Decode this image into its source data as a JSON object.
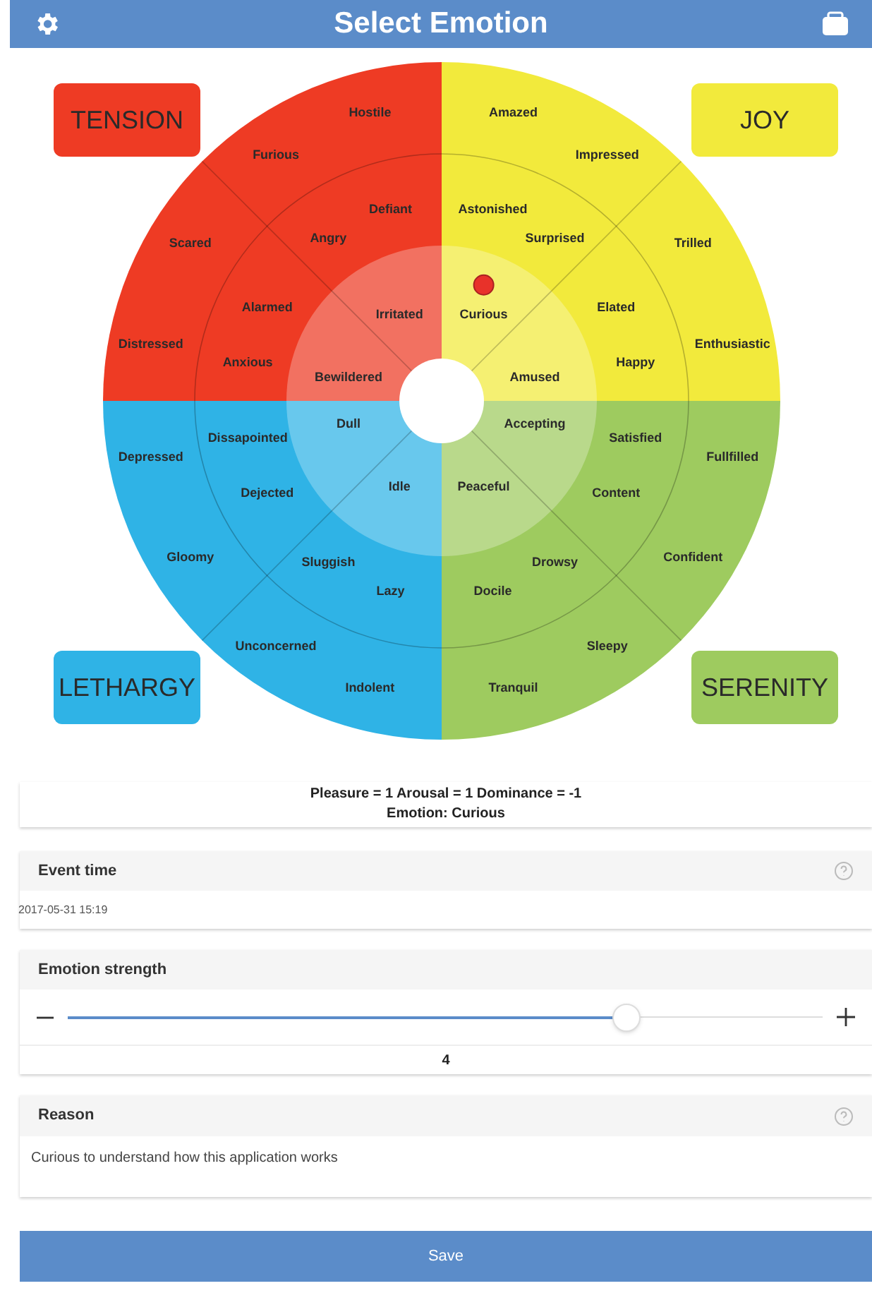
{
  "header": {
    "title": "Select Emotion"
  },
  "wheel": {
    "quadrants": [
      {
        "label": "TENSION",
        "color": "#ee3b24",
        "outer": [
          {
            "text": "Hostile",
            "selected": false
          },
          {
            "text": "Furious",
            "selected": false
          },
          {
            "text": "Scared",
            "selected": false
          },
          {
            "text": "Distressed",
            "selected": false
          }
        ],
        "middle": [
          {
            "text": "Defiant",
            "selected": false
          },
          {
            "text": "Angry",
            "selected": false
          },
          {
            "text": "Alarmed",
            "selected": false
          },
          {
            "text": "Anxious",
            "selected": false
          }
        ],
        "inner": [
          {
            "text": "Irritated",
            "selected": false
          },
          {
            "text": "Bewildered",
            "selected": false
          }
        ]
      },
      {
        "label": "JOY",
        "color": "#f2ea3c",
        "outer": [
          {
            "text": "Amazed",
            "selected": false
          },
          {
            "text": "Impressed",
            "selected": false
          },
          {
            "text": "Trilled",
            "selected": false
          },
          {
            "text": "Enthusiastic",
            "selected": false
          }
        ],
        "middle": [
          {
            "text": "Astonished",
            "selected": false
          },
          {
            "text": "Surprised",
            "selected": false
          },
          {
            "text": "Elated",
            "selected": false
          },
          {
            "text": "Happy",
            "selected": false
          }
        ],
        "inner": [
          {
            "text": "Curious",
            "selected": true
          },
          {
            "text": "Amused",
            "selected": false
          }
        ]
      },
      {
        "label": "LETHARGY",
        "color": "#2fb3e6",
        "outer": [
          {
            "text": "Depressed",
            "selected": false
          },
          {
            "text": "Gloomy",
            "selected": false
          },
          {
            "text": "Unconcerned",
            "selected": false
          },
          {
            "text": "Indolent",
            "selected": false
          }
        ],
        "middle": [
          {
            "text": "Dissapointed",
            "selected": false
          },
          {
            "text": "Dejected",
            "selected": false
          },
          {
            "text": "Sluggish",
            "selected": false
          },
          {
            "text": "Lazy",
            "selected": false
          }
        ],
        "inner": [
          {
            "text": "Dull",
            "selected": false
          },
          {
            "text": "Idle",
            "selected": false
          }
        ]
      },
      {
        "label": "SERENITY",
        "color": "#9ecb5f",
        "outer": [
          {
            "text": "Fullfilled",
            "selected": false
          },
          {
            "text": "Confident",
            "selected": false
          },
          {
            "text": "Sleepy",
            "selected": false
          },
          {
            "text": "Tranquil",
            "selected": false
          }
        ],
        "middle": [
          {
            "text": "Satisfied",
            "selected": false
          },
          {
            "text": "Content",
            "selected": false
          },
          {
            "text": "Drowsy",
            "selected": false
          },
          {
            "text": "Docile",
            "selected": false
          }
        ],
        "inner": [
          {
            "text": "Accepting",
            "selected": false
          },
          {
            "text": "Peaceful",
            "selected": false
          }
        ]
      }
    ]
  },
  "summary": {
    "line_1": "Pleasure = 1 Arousal = 1 Dominance = -1",
    "line_2": "Emotion: Curious"
  },
  "event_time": {
    "label": "Event time",
    "value": "2017-05-31 15:19"
  },
  "strength": {
    "label": "Emotion strength",
    "level": 0.74,
    "value": "4"
  },
  "reason": {
    "label": "Reason",
    "value": "Curious to understand how this application works"
  },
  "save_button": "Save"
}
